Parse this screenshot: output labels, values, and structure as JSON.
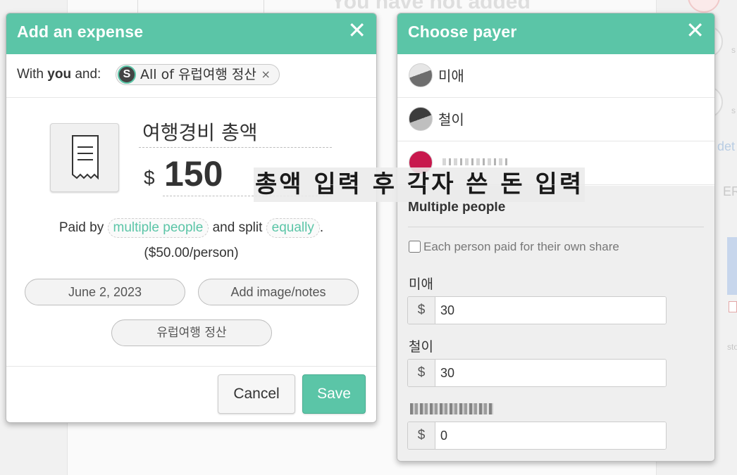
{
  "background": {
    "heading": "You have not added",
    "right_items": [
      "s",
      "s",
      "det",
      "ERT",
      "ston"
    ]
  },
  "expense_modal": {
    "title": "Add an expense",
    "with_prefix": "With ",
    "with_you": "you",
    "with_suffix": " and:",
    "group_token": "All of 유럽여행 정산",
    "group_token_avatar": "S",
    "token_remove": "×",
    "description": "여행경비 총액",
    "currency_symbol": "$",
    "amount": "150",
    "paid_by_prefix": "Paid by ",
    "paid_by": "multiple people",
    "split_prefix": " and split ",
    "split": "equally",
    "split_suffix": ".",
    "per_person": "($50.00/person)",
    "date": "June 2, 2023",
    "notes_button": "Add image/notes",
    "group_button": "유럽여행 정산",
    "cancel": "Cancel",
    "save": "Save",
    "accent": "#5bc5a7"
  },
  "payer_modal": {
    "title": "Choose payer",
    "payers": [
      {
        "name": "미애",
        "avatar": "gray-avatar"
      },
      {
        "name": "철이",
        "avatar": "dark-avatar"
      },
      {
        "name": "",
        "avatar": "red-avatar"
      }
    ],
    "multiple_title": "Multiple people",
    "own_share_label": "Each person paid for their own share",
    "shares": [
      {
        "name": "미애",
        "currency": "$",
        "amount": "30"
      },
      {
        "name": "철이",
        "currency": "$",
        "amount": "30"
      },
      {
        "name": "",
        "currency": "$",
        "amount": "0"
      }
    ]
  },
  "overlay_caption": "총액 입력 후 각자 쓴 돈 입력"
}
